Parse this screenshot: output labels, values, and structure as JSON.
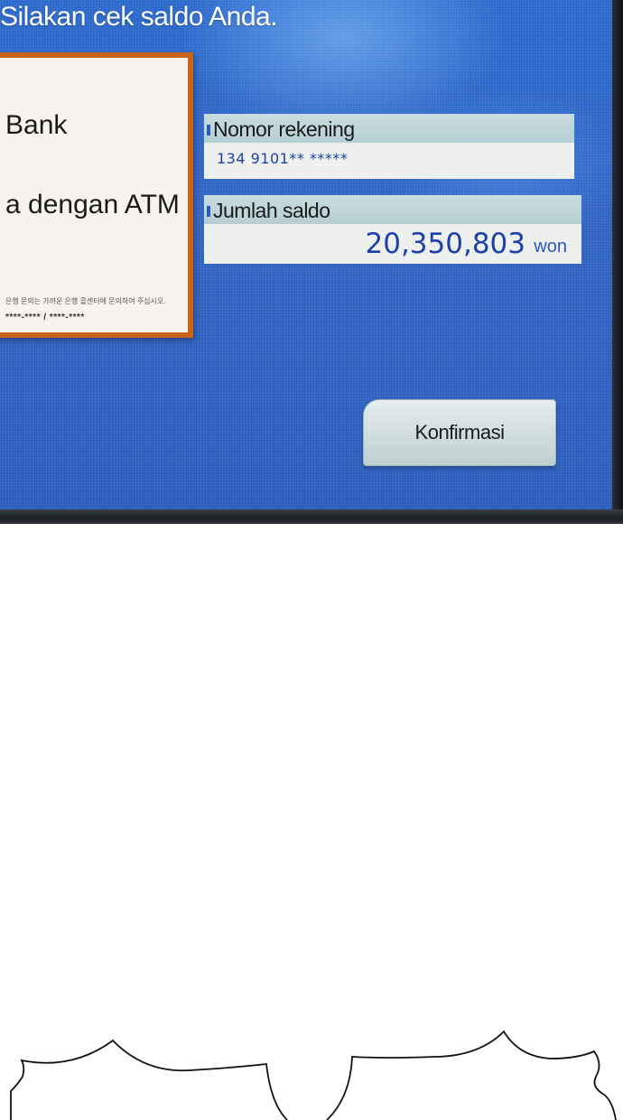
{
  "screen": {
    "prompt": "Silakan cek saldo Anda."
  },
  "info_card": {
    "line1": "Bank",
    "line2": "a dengan ATM",
    "fine_print": "은행 문의는 가까운 은행 콜센터에 문의하여 주십시오.",
    "phone_mask": "****-**** / ****-****"
  },
  "account": {
    "label": "Nomor rekening",
    "value": "134 9101** *****"
  },
  "balance": {
    "label": "Jumlah saldo",
    "amount": "20,350,803",
    "unit": "won"
  },
  "confirm": {
    "label": "Konfirmasi"
  },
  "colors": {
    "screen_blue": "#2f63c2",
    "card_border": "#c9641c",
    "value_text": "#1d3fa8"
  }
}
